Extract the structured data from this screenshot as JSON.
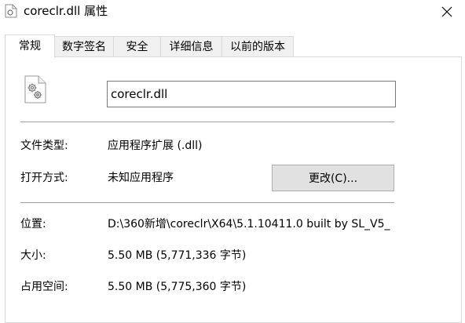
{
  "window": {
    "title": "coreclr.dll 属性",
    "icon": "file-icon"
  },
  "tabs": [
    {
      "label": "常规",
      "active": true
    },
    {
      "label": "数字签名"
    },
    {
      "label": "安全"
    },
    {
      "label": "详细信息"
    },
    {
      "label": "以前的版本"
    }
  ],
  "general": {
    "file_name": "coreclr.dll",
    "file_type_label": "文件类型:",
    "file_type_value": "应用程序扩展 (.dll)",
    "opens_with_label": "打开方式:",
    "opens_with_value": "未知应用程序",
    "change_button": "更改(C)...",
    "location_label": "位置:",
    "location_value": "D:\\360新增\\coreclr\\X64\\5.1.10411.0 built by SL_V5_",
    "size_label": "大小:",
    "size_value": "5.50 MB (5,771,336 字节)",
    "size_on_disk_label": "占用空间:",
    "size_on_disk_value": "5.50 MB (5,775,360 字节)"
  },
  "colors": {
    "panel_border": "#d9d9d9",
    "button_bg": "#e1e1e1",
    "separator": "#a0a0a0",
    "tab_bg": "#f0f0f0"
  }
}
